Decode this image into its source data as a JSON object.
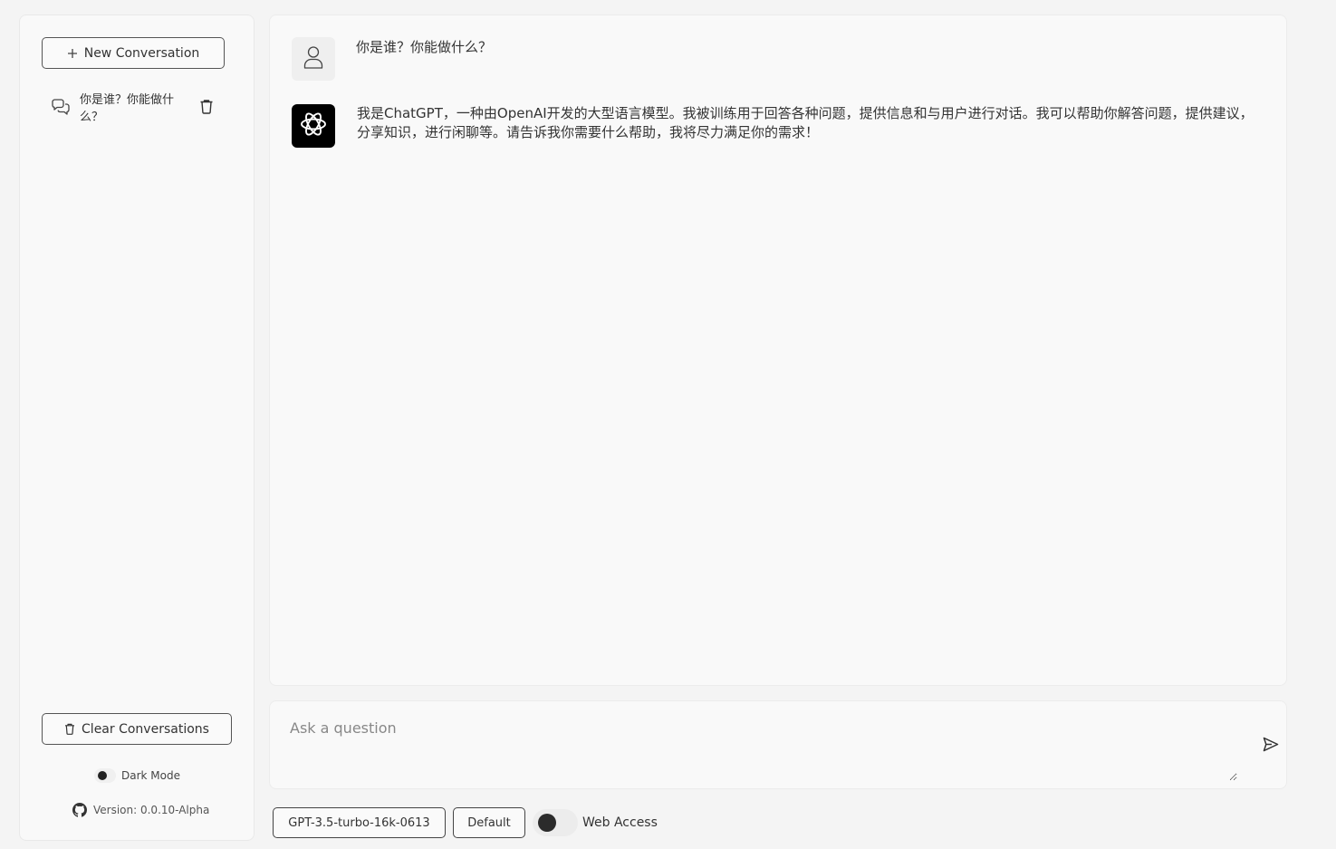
{
  "sidebar": {
    "new_conversation_label": "New Conversation",
    "conversations": [
      {
        "title": "你是谁？你能做什么？"
      }
    ],
    "clear_conversations_label": "Clear Conversations",
    "dark_mode_label": "Dark Mode",
    "version_label": "Version: 0.0.10-Alpha"
  },
  "chat": {
    "messages": [
      {
        "role": "user",
        "text": "你是谁？你能做什么？"
      },
      {
        "role": "assistant",
        "text": "我是ChatGPT，一种由OpenAI开发的大型语言模型。我被训练用于回答各种问题，提供信息和与用户进行对话。我可以帮助你解答问题，提供建议，分享知识，进行闲聊等。请告诉我你需要什么帮助，我将尽力满足你的需求！"
      }
    ]
  },
  "input": {
    "placeholder": "Ask a question",
    "value": ""
  },
  "bottom_bar": {
    "model_label": "GPT-3.5-turbo-16k-0613",
    "preset_label": "Default",
    "web_access_label": "Web Access"
  },
  "colors": {
    "background": "#f4f4f4",
    "panel": "#f9f9f9",
    "assistant_avatar": "#000000",
    "user_avatar": "#efefef"
  },
  "icons": {
    "new_conversation": "plus-icon",
    "conversation": "chat-bubbles-icon",
    "delete": "trash-icon",
    "clear": "trash-icon",
    "version": "github-icon",
    "user_avatar": "user-icon",
    "assistant_avatar": "openai-logo-icon",
    "send": "send-icon"
  }
}
